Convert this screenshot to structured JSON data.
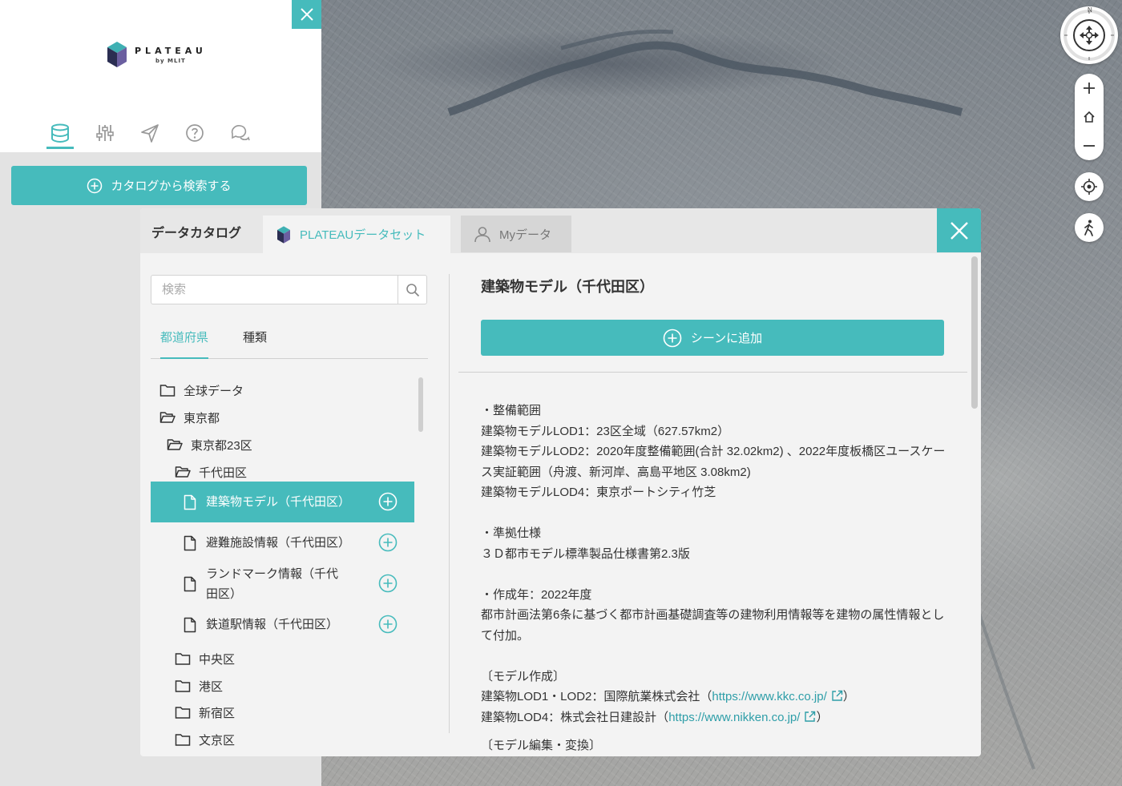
{
  "app": {
    "logo_word": "PLATEAU",
    "logo_sub": "by MLIT",
    "accent_color": "#46bbbc",
    "side_tabs": [
      {
        "icon": "database-icon",
        "active": true
      },
      {
        "icon": "sliders-icon",
        "active": false
      },
      {
        "icon": "send-icon",
        "active": false
      },
      {
        "icon": "help-icon",
        "active": false
      },
      {
        "icon": "chat-icon",
        "active": false
      }
    ],
    "catalog_search_label": "カタログから検索する"
  },
  "modal": {
    "title": "データカタログ",
    "tabs": [
      {
        "label": "PLATEAUデータセット",
        "active": true
      },
      {
        "label": "Myデータ",
        "active": false
      }
    ],
    "search_placeholder": "検索",
    "filter_tabs": [
      "都道府県",
      "種類"
    ],
    "tree": [
      {
        "label": "全球データ",
        "kind": "folder"
      },
      {
        "label": "東京都",
        "kind": "folder-open"
      },
      {
        "label": "東京都23区",
        "kind": "folder-open"
      },
      {
        "label": "千代田区",
        "kind": "folder-open"
      },
      {
        "label": "建築物モデル（千代田区）",
        "kind": "file",
        "selected": true
      },
      {
        "label": "避難施設情報（千代田区）",
        "kind": "file"
      },
      {
        "label": "ランドマーク情報（千代田区）",
        "kind": "file"
      },
      {
        "label": "鉄道駅情報（千代田区）",
        "kind": "file"
      },
      {
        "label": "中央区",
        "kind": "folder"
      },
      {
        "label": "港区",
        "kind": "folder"
      },
      {
        "label": "新宿区",
        "kind": "folder"
      },
      {
        "label": "文京区",
        "kind": "folder"
      }
    ],
    "detail": {
      "title": "建築物モデル（千代田区）",
      "add_label": "シーンに追加",
      "lines": [
        "・整備範囲",
        "建築物モデルLOD1：23区全域（627.57km2）",
        "建築物モデルLOD2：2020年度整備範囲(合計 32.02km2) 、2022年度板橋区ユースケース実証範囲（舟渡、新河岸、高島平地区 3.08km2)",
        "建築物モデルLOD4：東京ポートシティ竹芝",
        "",
        "・準拠仕様",
        "３Ｄ都市モデル標準製品仕様書第2.3版",
        "",
        "・作成年：2022年度",
        "都市計画法第6条に基づく都市計画基礎調査等の建物利用情報等を建物の属性情報として付加。",
        "",
        "〔モデル作成〕"
      ],
      "links": [
        {
          "prefix": "建築物LOD1・LOD2：国際航業株式会社（",
          "url": "https://www.kkc.co.jp/",
          "suffix": "）"
        },
        {
          "prefix": "建築物LOD4：株式会社日建設計（",
          "url": "https://www.nikken.co.jp/",
          "suffix": "）"
        }
      ],
      "cut_line": "〔モデル編集・変換〕"
    }
  },
  "map_controls": {
    "compass_north": "N"
  }
}
